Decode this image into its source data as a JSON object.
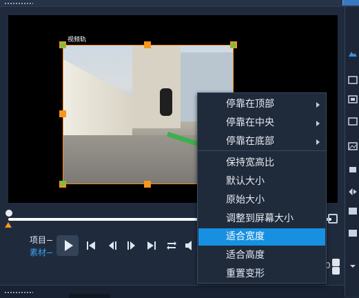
{
  "preview": {
    "track_label": "视频轨"
  },
  "mode": {
    "project_label": "项目",
    "clip_label": "素材"
  },
  "transport": {
    "buttons": [
      "play",
      "to-start",
      "prev-frame",
      "next-frame",
      "to-end",
      "repeat",
      "volume"
    ]
  },
  "context_menu": {
    "items": [
      {
        "label": "停靠在顶部",
        "submenu": true
      },
      {
        "label": "停靠在中央",
        "submenu": true
      },
      {
        "label": "停靠在底部",
        "submenu": true
      },
      {
        "label": "保持宽高比",
        "submenu": false
      },
      {
        "label": "默认大小",
        "submenu": false
      },
      {
        "label": "原始大小",
        "submenu": false
      },
      {
        "label": "调整到屏幕大小",
        "submenu": false
      },
      {
        "label": "适合宽度",
        "submenu": false,
        "highlighted": true
      },
      {
        "label": "适合高度",
        "submenu": false
      },
      {
        "label": "重置变形",
        "submenu": false
      }
    ]
  },
  "spinner": {
    "value": "0"
  },
  "colors": {
    "accent_orange": "#f7951d",
    "highlight_blue": "#1790e1",
    "mode_active": "#3aa0f0"
  }
}
